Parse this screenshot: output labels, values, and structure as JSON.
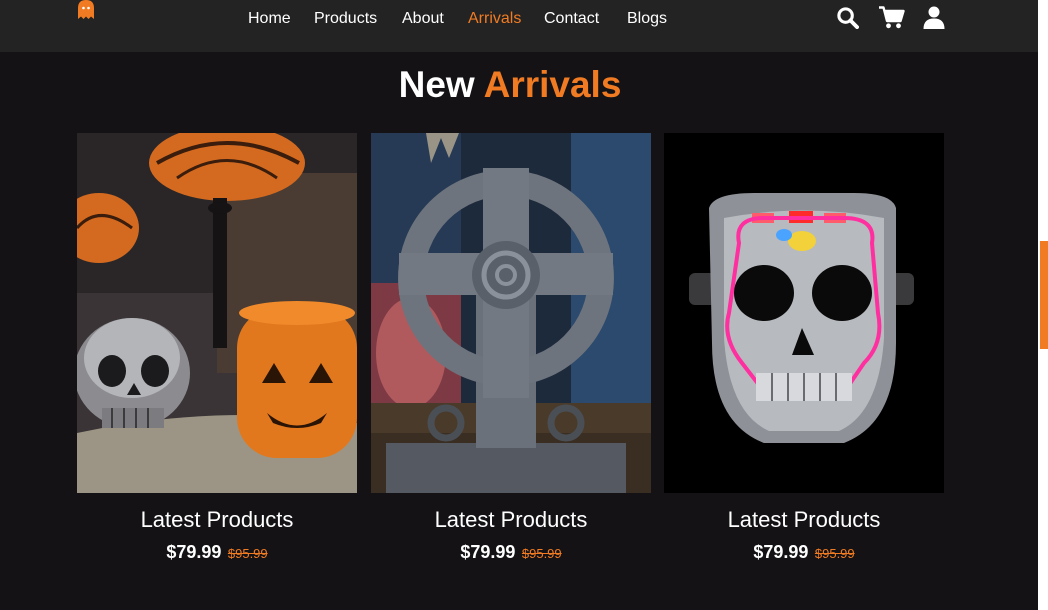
{
  "nav": {
    "items": [
      {
        "label": "Home"
      },
      {
        "label": "Products"
      },
      {
        "label": "About"
      },
      {
        "label": "Arrivals",
        "active": true
      },
      {
        "label": "Contact"
      },
      {
        "label": "Blogs"
      }
    ]
  },
  "icons": {
    "logo": "ghost-icon",
    "search": "search-icon",
    "cart": "cart-icon",
    "user": "user-icon"
  },
  "section": {
    "title_plain": "New",
    "title_accent": "Arrivals"
  },
  "products": [
    {
      "name": "Latest Products",
      "price": "$79.99",
      "old_price": "$95.99",
      "image": "skull and jack-o-lantern decor"
    },
    {
      "name": "Latest Products",
      "price": "$79.99",
      "old_price": "$95.99",
      "image": "celtic cross tombstone"
    },
    {
      "name": "Latest Products",
      "price": "$79.99",
      "old_price": "$95.99",
      "image": "led skull mask"
    }
  ],
  "colors": {
    "accent": "#f07b22",
    "background": "#141215",
    "header": "#232323"
  }
}
